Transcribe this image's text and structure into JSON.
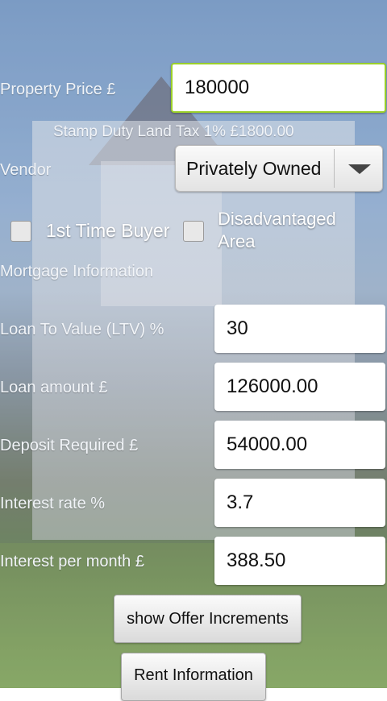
{
  "property": {
    "price_label": "Property Price £",
    "price_value": "180000",
    "stamp_duty_text": "Stamp Duty Land Tax  1%   £1800.00"
  },
  "vendor": {
    "label": "Vendor",
    "selected": "Privately Owned"
  },
  "checks": {
    "first_time_buyer": "1st Time Buyer",
    "disadvantaged_line1": "Disadvantaged",
    "disadvantaged_line2": "Area"
  },
  "mortgage": {
    "section_label": "Mortgage Information",
    "ltv_label": "Loan To Value (LTV) %",
    "ltv_value": "30",
    "loan_label": "Loan amount £",
    "loan_value": "126000.00",
    "deposit_label": "Deposit Required £",
    "deposit_value": "54000.00",
    "rate_label": "Interest rate %",
    "rate_value": "3.7",
    "monthly_label": "Interest per month £",
    "monthly_value": "388.50"
  },
  "buttons": {
    "offer_increments": "show Offer Increments",
    "rent_info": "Rent Information"
  }
}
